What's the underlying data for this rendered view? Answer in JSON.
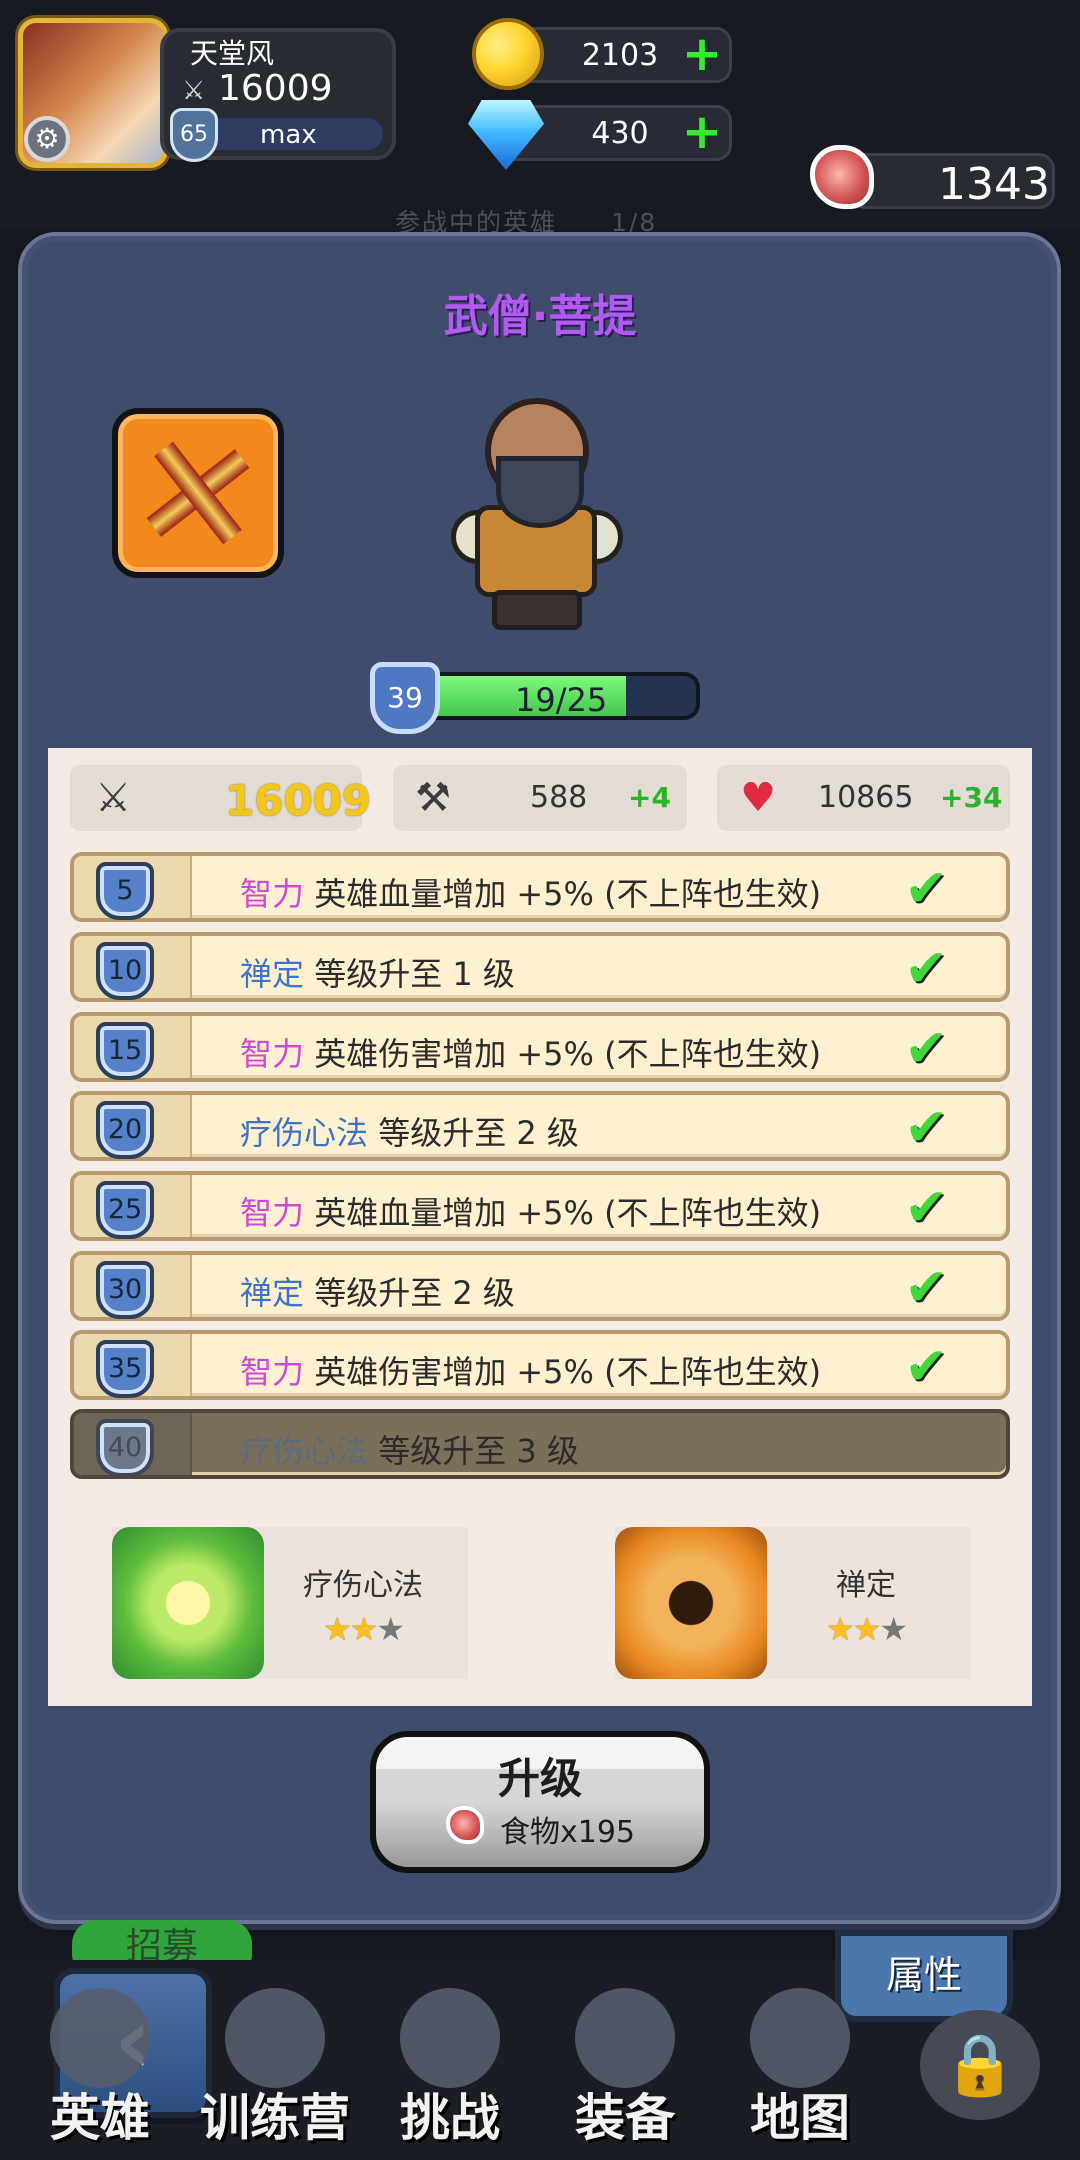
{
  "player": {
    "name": "天堂风",
    "power": "16009",
    "level": "65",
    "max_label": "max",
    "settings_icon": "gear-icon"
  },
  "currency": {
    "coins": "2103",
    "gems": "430",
    "food": "1343"
  },
  "under_heading": {
    "text": "参战中的英雄",
    "count": "1/8"
  },
  "hero": {
    "name": "武僧·菩提",
    "level": "39",
    "xp_text": "19/25",
    "xp_ratio": 0.76
  },
  "stats": {
    "power": "16009",
    "attack": "588",
    "attack_bonus": "+4",
    "hp": "10865",
    "hp_bonus": "+34"
  },
  "talents": [
    {
      "level": "5",
      "attr": "智力",
      "desc": "英雄血量增加 +5% (不上阵也生效)",
      "color": "#cc4bd2",
      "unlocked": true
    },
    {
      "level": "10",
      "attr": "禅定",
      "desc": "等级升至 1 级",
      "color": "#3f73c9",
      "unlocked": true
    },
    {
      "level": "15",
      "attr": "智力",
      "desc": "英雄伤害增加 +5% (不上阵也生效)",
      "color": "#cc4bd2",
      "unlocked": true
    },
    {
      "level": "20",
      "attr": "疗伤心法",
      "desc": "等级升至 2 级",
      "color": "#3f73c9",
      "unlocked": true
    },
    {
      "level": "25",
      "attr": "智力",
      "desc": "英雄血量增加 +5% (不上阵也生效)",
      "color": "#cc4bd2",
      "unlocked": true
    },
    {
      "level": "30",
      "attr": "禅定",
      "desc": "等级升至 2 级",
      "color": "#3f73c9",
      "unlocked": true
    },
    {
      "level": "35",
      "attr": "智力",
      "desc": "英雄伤害增加 +5% (不上阵也生效)",
      "color": "#cc4bd2",
      "unlocked": true
    },
    {
      "level": "40",
      "attr": "疗伤心法",
      "desc": "等级升至 3 级",
      "color": "#5d6b82",
      "unlocked": false
    }
  ],
  "skills": [
    {
      "name": "疗伤心法",
      "stars": 2,
      "max_stars": 3
    },
    {
      "name": "禅定",
      "stars": 2,
      "max_stars": 3
    }
  ],
  "upgrade": {
    "title": "升级",
    "cost": "食物x195"
  },
  "nav": {
    "tabs": [
      "英雄",
      "训练营",
      "挑战",
      "装备",
      "地图"
    ],
    "attr_tab": "属性",
    "recruit": "招募"
  }
}
